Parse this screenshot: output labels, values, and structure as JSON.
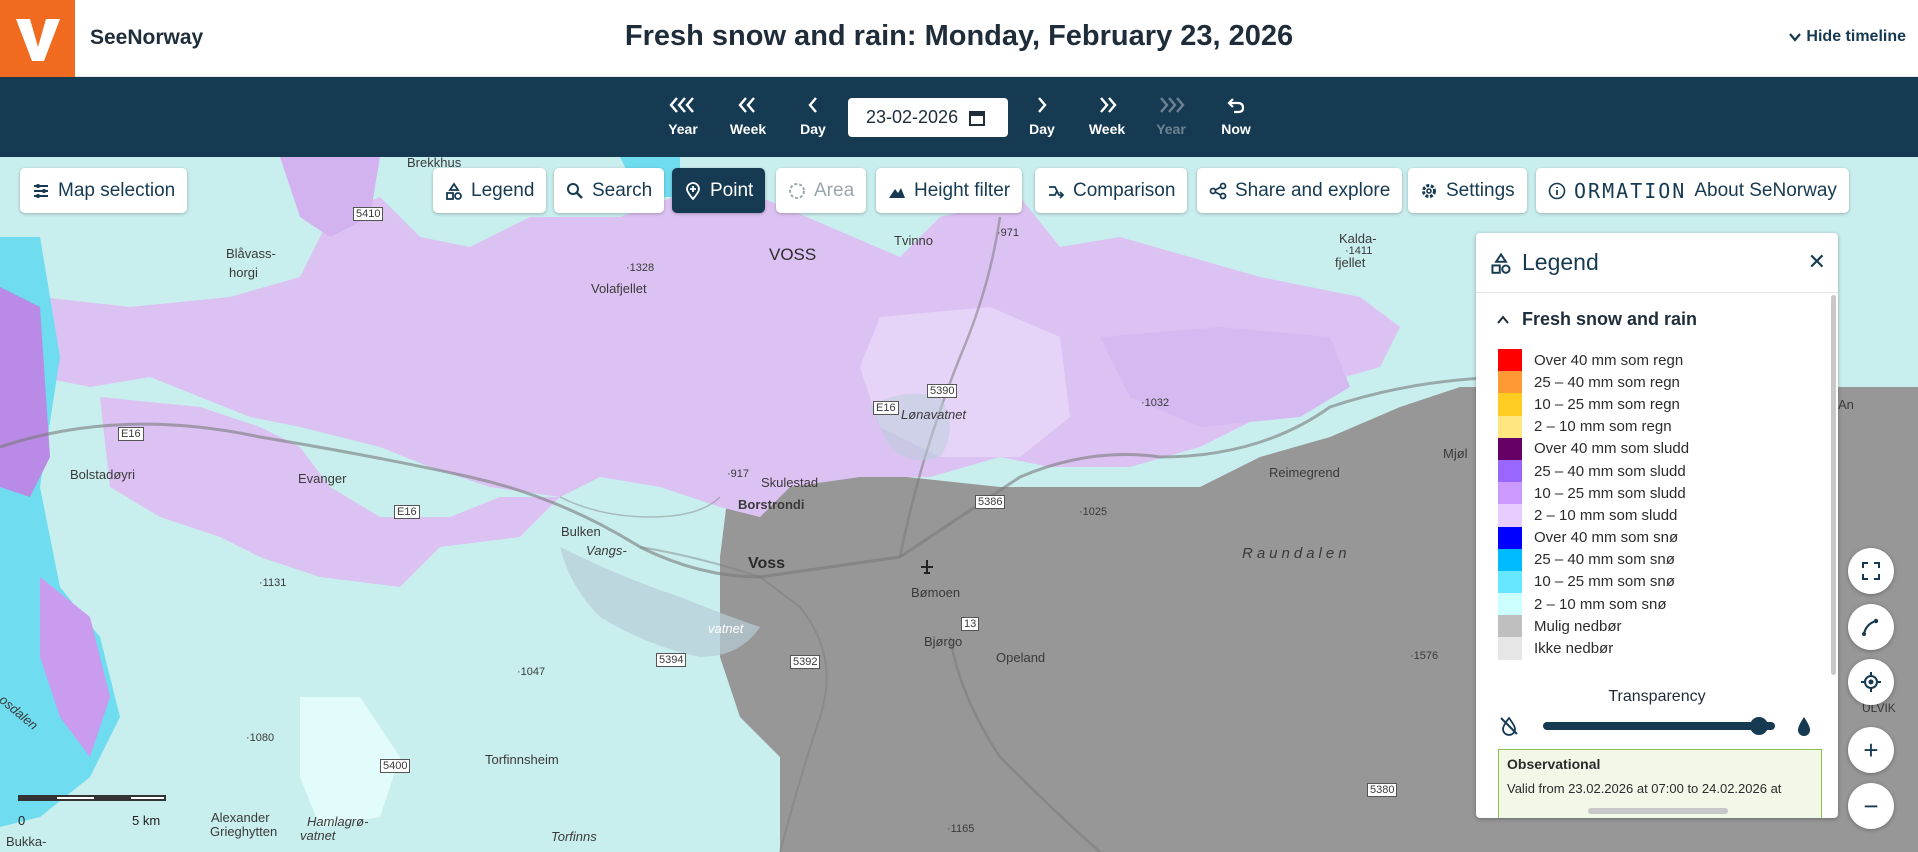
{
  "header": {
    "logo_letter": "V",
    "brand": "SeeNorway",
    "title": "Fresh snow and rain: Monday, February 23, 2026",
    "hide_timeline": "Hide timeline"
  },
  "timeline": {
    "buttons": [
      {
        "label": "Year",
        "icon": "triple-chevron-left-icon",
        "enabled": true
      },
      {
        "label": "Week",
        "icon": "double-chevron-left-icon",
        "enabled": true
      },
      {
        "label": "Day",
        "icon": "chevron-left-icon",
        "enabled": true
      },
      {
        "label": "Day",
        "icon": "chevron-right-icon",
        "enabled": true
      },
      {
        "label": "Week",
        "icon": "double-chevron-right-icon",
        "enabled": true
      },
      {
        "label": "Year",
        "icon": "triple-chevron-right-icon",
        "enabled": false
      },
      {
        "label": "Now",
        "icon": "undo-arrow-icon",
        "enabled": true
      }
    ],
    "date_value": "23-02-2026"
  },
  "toolbar": {
    "map_selection": "Map selection",
    "legend": "Legend",
    "search": "Search",
    "point": "Point",
    "area": "Area",
    "height_filter": "Height filter",
    "comparison": "Comparison",
    "share": "Share and explore",
    "settings": "Settings",
    "info_banner": "ORMATION",
    "about": "About SeNorway",
    "active_tool": "Point"
  },
  "legend_panel": {
    "title": "Legend",
    "section": "Fresh snow and rain",
    "items": [
      {
        "label": "Over 40 mm som regn",
        "color": "#ff0000"
      },
      {
        "label": "25 – 40 mm som regn",
        "color": "#ff9933"
      },
      {
        "label": "10 – 25 mm som regn",
        "color": "#ffcc22"
      },
      {
        "label": "2 – 10 mm som regn",
        "color": "#ffe680"
      },
      {
        "label": "Over 40 mm som sludd",
        "color": "#660066"
      },
      {
        "label": "25 – 40 mm som sludd",
        "color": "#9966ff"
      },
      {
        "label": "10 – 25 mm som sludd",
        "color": "#cc99ff"
      },
      {
        "label": "2 – 10 mm som sludd",
        "color": "#e6ccff"
      },
      {
        "label": "Over 40 mm som snø",
        "color": "#0000ff"
      },
      {
        "label": "25 – 40 mm som snø",
        "color": "#00bbff"
      },
      {
        "label": "10 – 25 mm som snø",
        "color": "#66e6ff"
      },
      {
        "label": "2 – 10 mm som snø",
        "color": "#ccffff"
      },
      {
        "label": "Mulig nedbør",
        "color": "#bfbfbf"
      },
      {
        "label": "Ikke nedbør",
        "color": "#e6e6e6"
      }
    ],
    "transparency_label": "Transparency",
    "transparency_value": 0.93,
    "observational_title": "Observational",
    "observational_text": "Valid from 23.02.2026 at 07:00 to 24.02.2026 at"
  },
  "map": {
    "places": [
      "Brekkhus",
      "Blåvass-",
      "horgi",
      "VOSS",
      "Tvinno",
      "Kalda-",
      "·1411",
      "fjellet",
      "·1328",
      "Volafjellet",
      "5410",
      "·971",
      "E16",
      "5390",
      "Lønavatnet",
      "·1032",
      "E16",
      "Bolstadøyri",
      "Evanger",
      "E16",
      "·917",
      "Skulestad",
      "Borstrondi",
      "5386",
      "·1025",
      "Reimegrend",
      "Mjøl",
      "Bulken",
      "Voss",
      "Raundalen",
      "Vangs-",
      "Bømoen",
      "·1131",
      "vatnet",
      "5394",
      "5392",
      "Bjørgo",
      "13",
      "Opeland",
      "·1576",
      "·1047",
      "·1080",
      "5400",
      "Torfinnsheim",
      "5380",
      "Alexander",
      "Grieghytten",
      "Hamlagrø-",
      "vatnet",
      "Torfinns",
      "·1165",
      "Bukka-",
      "osdalen",
      "ULVIK",
      "An"
    ],
    "scale_labels": [
      "0",
      "5 km"
    ]
  },
  "controls": {
    "fullscreen": "fullscreen-icon",
    "draw": "draw-line-icon",
    "locate": "locate-icon",
    "zoom_in": "+",
    "zoom_out": "−"
  }
}
